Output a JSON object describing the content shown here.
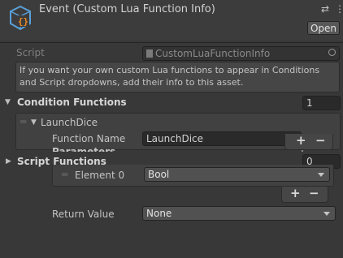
{
  "header": {
    "title": "Event (Custom Lua Function Info)",
    "open_label": "Open",
    "icon_names": [
      "scriptable-object-icon",
      "tune-icon",
      "more-icon"
    ]
  },
  "script": {
    "label": "Script",
    "value": "CustomLuaFunctionInfo"
  },
  "help_text": "If you want your own custom Lua functions to appear in Conditions and Script dropdowns, add their info to this asset.",
  "condition_functions": {
    "label": "Condition Functions",
    "count": "1",
    "element": {
      "name": "LaunchDice",
      "function_name_label": "Function Name",
      "function_name_value": "LaunchDice",
      "parameters_label": "Parameters",
      "parameters_count": "1"
    }
  },
  "script_functions": {
    "label": "Script Functions",
    "count": "0"
  },
  "parameters_list": {
    "element_label": "Element 0",
    "element_value": "Bool"
  },
  "return_value": {
    "label": "Return Value",
    "value": "None"
  },
  "buttons": {
    "plus": "+",
    "minus": "−"
  },
  "colors": {
    "background": "#383838",
    "header": "#3c3c3c",
    "field": "#2a2a2a",
    "accent_orange": "#f08a24",
    "accent_blue": "#5aa0d8"
  }
}
